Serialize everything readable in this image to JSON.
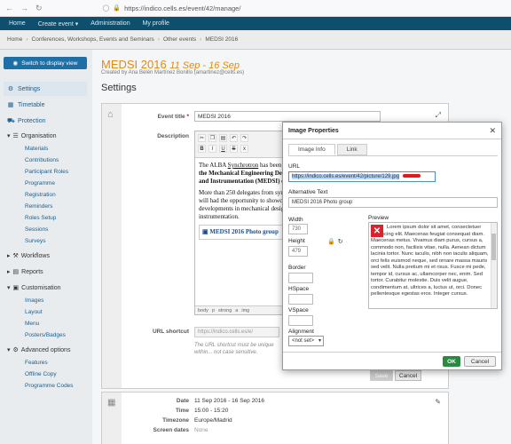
{
  "browser": {
    "url": "https://indico.cells.es/event/42/manage/"
  },
  "topmenu": {
    "items": [
      "Home",
      "Create event ▾",
      "Administration",
      "My profile"
    ]
  },
  "breadcrumb": [
    "Home",
    "Conferences, Workshops, Events and Seminars",
    "Other events",
    "MEDSI 2016"
  ],
  "sidebar": {
    "switch_label": "Switch to display view",
    "items": [
      {
        "label": "Settings",
        "icon": "gear-icon"
      },
      {
        "label": "Timetable",
        "icon": "calendar-icon"
      },
      {
        "label": "Protection",
        "icon": "shield-icon"
      }
    ],
    "organisation": {
      "label": "Organisation",
      "items": [
        "Materials",
        "Contributions",
        "Participant Roles",
        "Programme",
        "Registration",
        "Reminders",
        "Roles Setup",
        "Sessions",
        "Surveys"
      ]
    },
    "workflows": "Workflows",
    "reports": "Reports",
    "customisation": {
      "label": "Customisation",
      "items": [
        "Images",
        "Layout",
        "Menu",
        "Posters/Badges"
      ]
    },
    "advanced": {
      "label": "Advanced options",
      "items": [
        "Features",
        "Offline Copy",
        "Programme Codes"
      ]
    }
  },
  "main": {
    "event_name": "MEDSI 2016",
    "event_dates": "11 Sep - 16 Sep",
    "created_by": "Created by Ana Belén Martínez Bonillo (amartinez@cells.es)",
    "settings_heading": "Settings",
    "form": {
      "event_title_label": "Event title",
      "event_title_value": "MEDSI 2016",
      "description_label": "Description",
      "description_p1_start": "The ALBA ",
      "description_p1_link": "Synchrotron",
      "description_p1_rest": " has been p",
      "description_bold1": "the Mechanical Engineering Des",
      "description_bold2": "and Instrumentation (MEDSI) co",
      "description_p2": "More than 250 delegates from syno will had the opportunity to showca developments in mechanical design instrumentation.",
      "description_img_caption": "MEDSI 2016 Photo group",
      "editor_path": [
        "body",
        "p",
        "strong",
        "a",
        "img"
      ],
      "url_shortcut_label": "URL shortcut",
      "url_shortcut_placeholder": "https://indico.cells.es/e/",
      "url_shortcut_help": "The URL shortcut must be unique within... not case sensitive.",
      "save_label": "Save",
      "cancel_label": "Cancel"
    },
    "details": {
      "date_label": "Date",
      "date_value": "11 Sep 2016 - 16 Sep 2016",
      "time_label": "Time",
      "time_value": "15:00 - 15:20",
      "timezone_label": "Timezone",
      "timezone_value": "Europe/Madrid",
      "screen_dates_label": "Screen dates",
      "screen_dates_value": "None"
    }
  },
  "modal": {
    "title": "Image Properties",
    "tabs": [
      "Image Info",
      "Link"
    ],
    "url_label": "URL",
    "url_value": "https://indico.cells.es/event/42/picture/129.jpg",
    "alt_label": "Alternative Text",
    "alt_value": "MEDSI 2016 Photo group",
    "width_label": "Width",
    "width_value": "730",
    "height_label": "Height",
    "height_value": "479",
    "border_label": "Border",
    "hspace_label": "HSpace",
    "vspace_label": "VSpace",
    "alignment_label": "Alignment",
    "alignment_value": "<not set>",
    "preview_label": "Preview",
    "preview_text": "Lorem ipsum dolor sit amet, consectetuer adipiscing elit. Maecenas feugiat consequat diam. Maecenas metus. Vivamus diam purus, cursus a, commodo non, facilisis vitae, nulla. Aenean dictum lacinia tortor. Nunc iaculis, nibh non iaculis aliquam, orci felis euismod neque, sed ornare massa mauris sed velit. Nulla pretium mi et risus. Fusce mi pede, tempor id, cursus ac, ullamcorper nec, enim. Sed tortor. Curabitur molestie. Duis velit augue, condimentum at, ultrices a, luctus ut, orci. Donec pellentesque egestas eros. Integer cursus.",
    "ok_label": "OK",
    "cancel_label": "Cancel",
    "colors": {
      "ok": "#2a8a3f",
      "accent": "#e08a16",
      "nav": "#0f4f6e"
    }
  }
}
